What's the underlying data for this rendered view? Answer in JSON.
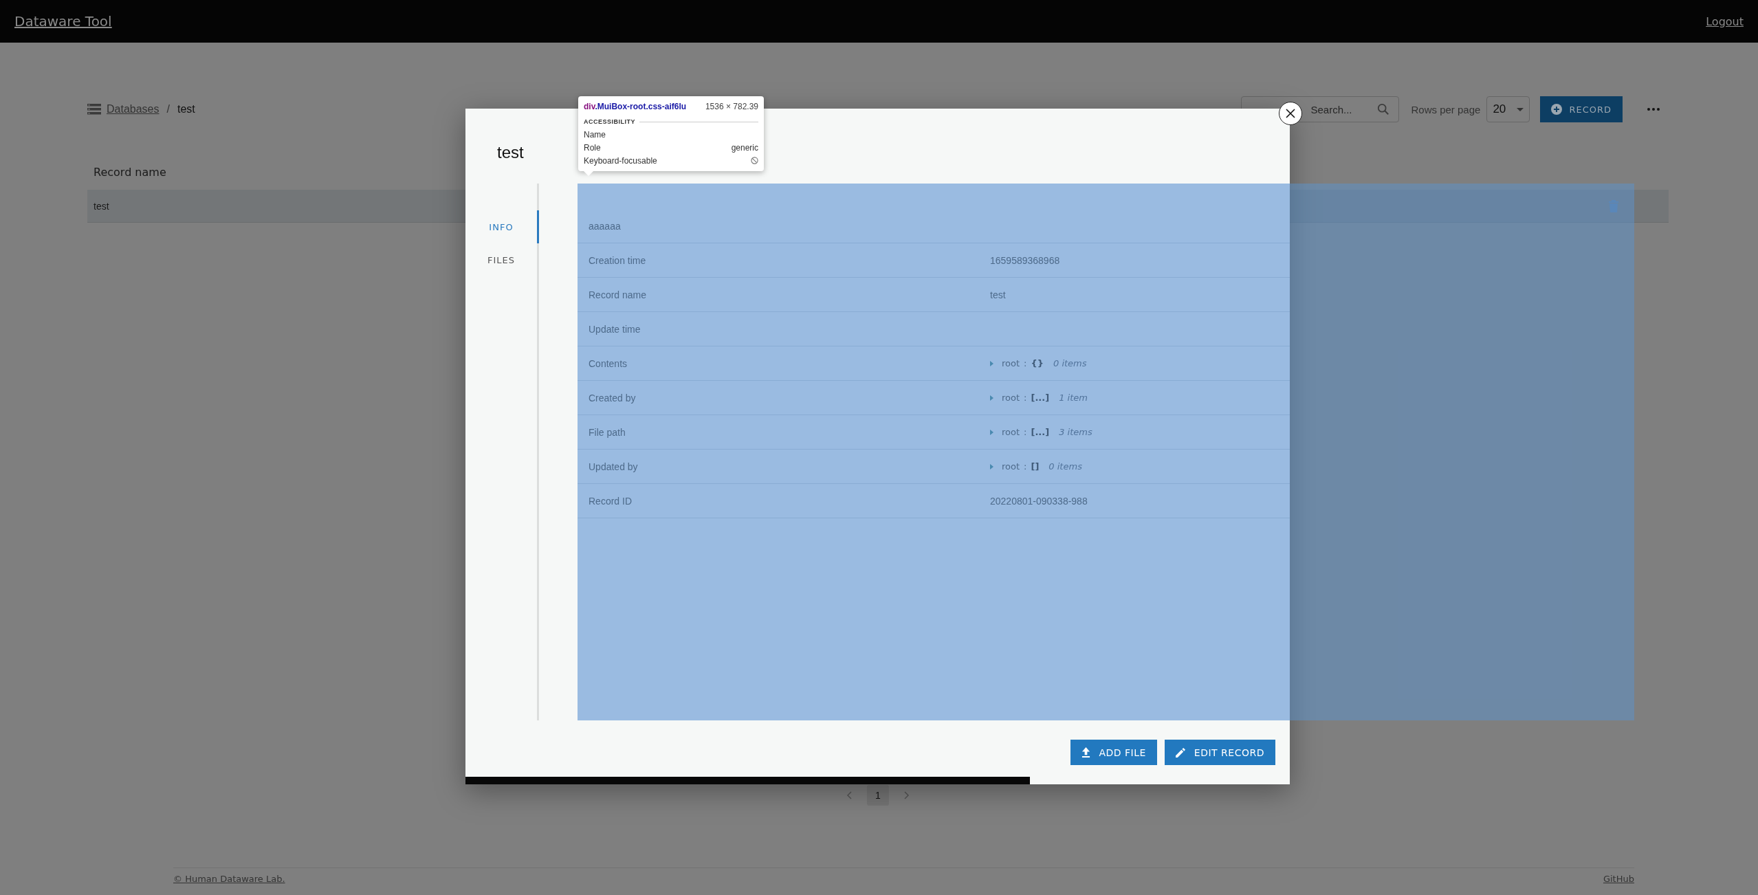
{
  "app_bar": {
    "title": "Dataware Tool",
    "logout": "Logout"
  },
  "breadcrumb": {
    "link": "Databases",
    "separator": "/",
    "current": "test"
  },
  "toolbar": {
    "search": {
      "placeholder": "Search..."
    },
    "rows_per_page_label": "Rows per page",
    "rows_per_page": "20",
    "add_button": "RECORD"
  },
  "table": {
    "columns": [
      "Record name"
    ],
    "rows": [
      {
        "cells": [
          "test"
        ]
      }
    ]
  },
  "pagination": {
    "pages": [
      {
        "label": "1",
        "selected": true
      }
    ]
  },
  "footer": {
    "copyright": "© Human Dataware Lab.",
    "link": "GitHub"
  },
  "dialog": {
    "title": "test",
    "tabs": [
      {
        "label": "INFO",
        "selected": true
      },
      {
        "label": "FILES",
        "selected": false
      }
    ],
    "fields": [
      {
        "label": "aaaaaa",
        "kind": "text"
      },
      {
        "label": "Creation time",
        "kind": "text",
        "value": "1659589368968"
      },
      {
        "label": "Record name",
        "kind": "text",
        "value": "test"
      },
      {
        "label": "Update time",
        "kind": "text"
      },
      {
        "label": "Contents",
        "kind": "tree",
        "key": "root",
        "separator": ":",
        "bracket": "{}",
        "count": "0 items"
      },
      {
        "label": "Created by",
        "kind": "tree",
        "key": "root",
        "separator": ":",
        "bracket": "[...]",
        "count": "1 item"
      },
      {
        "label": "File path",
        "kind": "tree",
        "key": "root",
        "separator": ":",
        "bracket": "[...]",
        "count": "3 items"
      },
      {
        "label": "Updated by",
        "kind": "tree",
        "key": "root",
        "separator": ":",
        "bracket": "[]",
        "count": "0 items"
      },
      {
        "label": "Record ID",
        "kind": "text",
        "value": "20220801-090338-988"
      }
    ],
    "buttons": [
      {
        "label": "ADD FILE",
        "kind": "upload"
      },
      {
        "label": "EDIT RECORD",
        "kind": "edit"
      }
    ]
  },
  "inspector_tooltip": {
    "tag": "div",
    "classes": ".MuiBox-root.css-aif6lu",
    "size": "1536 × 782.39",
    "section": "ACCESSIBILITY",
    "rows": [
      {
        "label": "Name"
      },
      {
        "label": "Role",
        "value": "generic"
      },
      {
        "label": "Keyboard-focusable",
        "focusable": false
      }
    ]
  }
}
